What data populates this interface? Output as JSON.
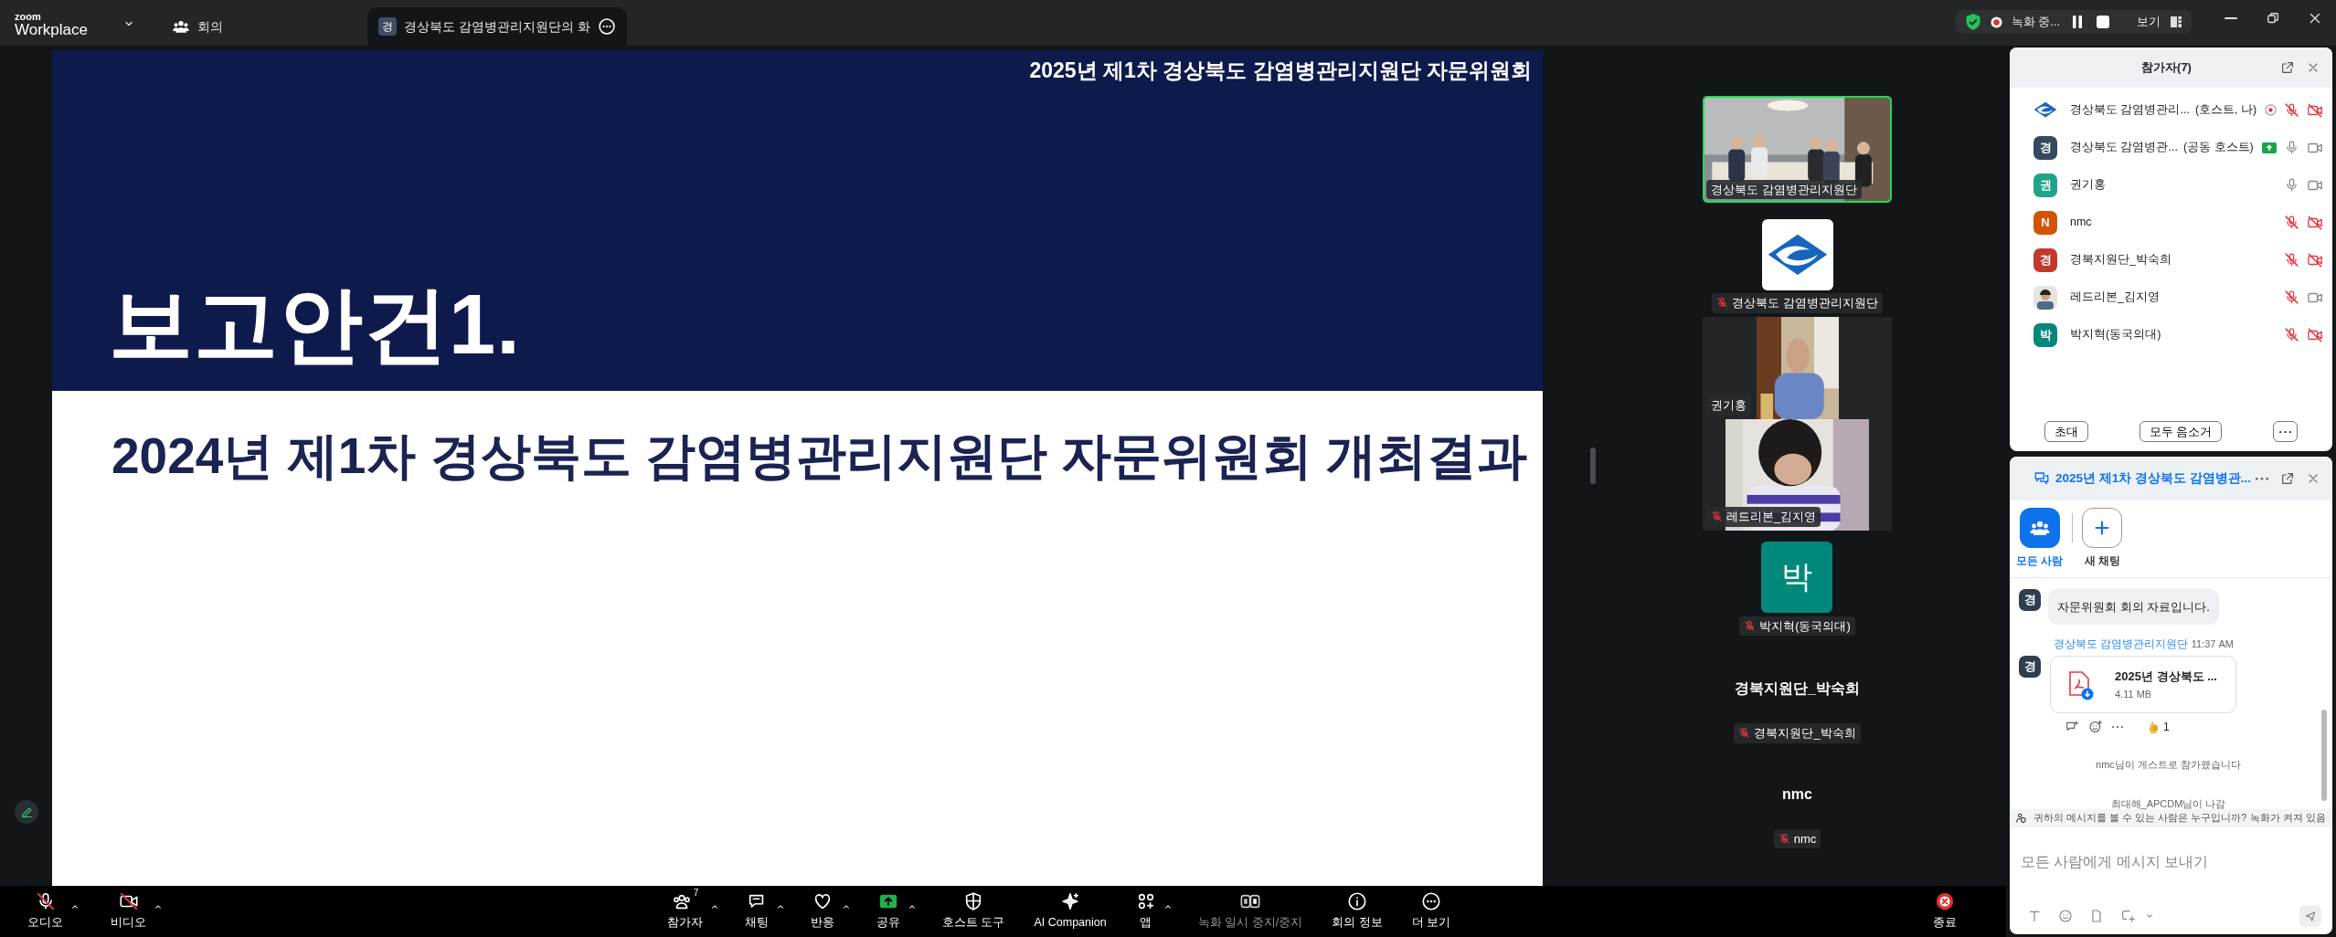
{
  "top_bar": {
    "brand_small": "zoom",
    "brand": "Workplace",
    "tabs": [
      {
        "kind": "home",
        "label": "회의",
        "selected": false
      },
      {
        "kind": "meeting",
        "initial": "경",
        "label": "경상북도 감염병관리지원단의 화",
        "selected": true
      }
    ],
    "recording": {
      "status": "녹화 중...",
      "view_label": "보기"
    }
  },
  "slide": {
    "header": "2025년 제1차 경상북도 감염병관리지원단 자문위원회",
    "title": "보고안건1.",
    "subtitle": "2024년 제1차 경상북도 감염병관리지원단 자문위원회 개최결과"
  },
  "video_tiles": [
    {
      "kind": "camera",
      "label": "경상북도 감염병관리지원단",
      "muted": false,
      "speaking": true
    },
    {
      "kind": "logo",
      "label": "경상북도 감염병관리지원단",
      "muted": true,
      "speaking": false
    },
    {
      "kind": "camera",
      "label": "권기홍",
      "muted": false,
      "speaking": false
    },
    {
      "kind": "camera",
      "label": "레드리본_김지영",
      "muted": true,
      "speaking": false
    },
    {
      "kind": "avatar",
      "initial": "박",
      "color": "#00897b",
      "label": "박지혁(동국의대)",
      "muted": true,
      "speaking": false
    },
    {
      "kind": "name",
      "display": "경북지원단_박숙희",
      "label": "경북지원단_박숙희",
      "muted": true,
      "speaking": false
    },
    {
      "kind": "name",
      "display": "nmc",
      "label": "nmc",
      "muted": true,
      "speaking": false
    }
  ],
  "participants": {
    "title": "참가자(7)",
    "items": [
      {
        "kind": "logo",
        "name": "경상북도 감염병관리...",
        "role": "(호스트, 나)",
        "recording": true,
        "mic_muted": true,
        "video_off": true
      },
      {
        "kind": "initial",
        "initial": "경",
        "color": "#34495e",
        "name": "경상북도 감염병관...",
        "role": "(공동 호스트)",
        "sharing": true,
        "mic_muted": false,
        "video_off": false
      },
      {
        "kind": "initial",
        "initial": "권",
        "color": "#1fa38a",
        "name": "권기홍",
        "mic_muted": false,
        "video_off": false
      },
      {
        "kind": "initial",
        "initial": "N",
        "color": "#d35400",
        "name": "nmc",
        "mic_muted": true,
        "video_off": true
      },
      {
        "kind": "initial",
        "initial": "경",
        "color": "#c0392b",
        "name": "경북지원단_박숙희",
        "mic_muted": true,
        "video_off": true
      },
      {
        "name": "레드리본_김지영",
        "mic_muted": true,
        "video_off": false
      },
      {
        "kind": "initial",
        "initial": "박",
        "color": "#00897b",
        "name": "박지혁(동국의대)",
        "mic_muted": true,
        "video_off": true
      }
    ],
    "buttons": [
      "초대",
      "모두 음소거"
    ]
  },
  "chat": {
    "title": "2025년 제1차 경상북도 감염병관...",
    "tabs": [
      {
        "label": "모든 사람",
        "selected": true
      },
      {
        "label": "새 채팅",
        "selected": false
      }
    ],
    "messages": [
      {
        "kind": "text",
        "initial": "경",
        "text": "자문위원회 회의 자료입니다."
      },
      {
        "kind": "file",
        "sender": "경상북도 감염병관리지원단",
        "time": "11:37 AM",
        "initial": "경",
        "file_name": "2025년 경상북도 ...",
        "file_size": "4.11 MB",
        "reaction_count": "1"
      },
      {
        "kind": "system",
        "text": "nmc님이 게스트로 참가했습니다"
      },
      {
        "kind": "system",
        "text": "최대해_APCDM님이 나감"
      }
    ],
    "notice": "귀하의 메시지를 볼 수 있는 사람은 누구입니까? 녹화가 켜져 있음",
    "placeholder": "모든 사람에게 메시지 보내기"
  },
  "toolbar": {
    "items": [
      {
        "label": "오디오",
        "off": true,
        "caret": true
      },
      {
        "label": "비디오",
        "off": true,
        "caret": true
      },
      {
        "label": "참가자",
        "count": "7",
        "caret": true
      },
      {
        "label": "채팅",
        "caret": true
      },
      {
        "label": "반응",
        "caret": true
      },
      {
        "label": "공유",
        "caret": true
      },
      {
        "label": "호스트 도구",
        "caret": false
      },
      {
        "label": "AI Companion",
        "caret": false
      },
      {
        "label": "앱",
        "caret": true
      },
      {
        "label": "녹화 일시 중지/중지",
        "caret": false,
        "disabled": true
      },
      {
        "label": "회의 정보",
        "caret": false
      },
      {
        "label": "더 보기",
        "caret": false
      }
    ],
    "end_label": "종료"
  }
}
